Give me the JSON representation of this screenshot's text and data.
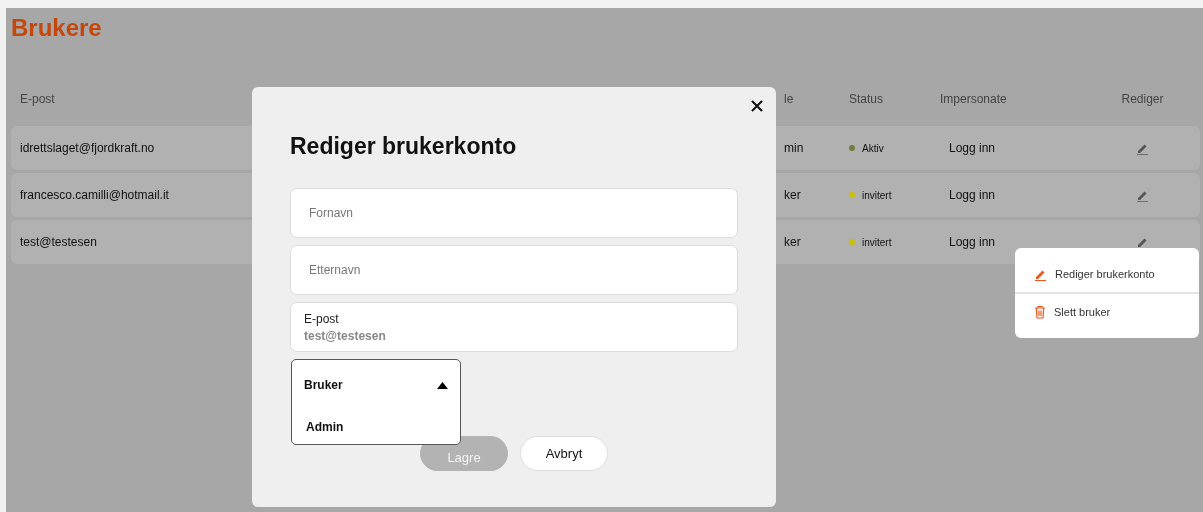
{
  "page_title": "Brukere",
  "table": {
    "columns": [
      "E-post",
      "le",
      "Status",
      "Impersonate",
      "Rediger"
    ],
    "rows": [
      {
        "email": "idrettslaget@fjordkraft.no",
        "column_2": "min",
        "status": "Aktiv",
        "color": "#6e7d3c",
        "impersonate": "Logg inn"
      },
      {
        "email": "francesco.camilli@hotmail.it",
        "column_2": "ker",
        "status": "invitert",
        "color": "#c9c200",
        "impersonate": "Logg inn"
      },
      {
        "email": "test@testesen",
        "column_2": "ker",
        "status": "invitert",
        "color": "#c9c200",
        "impersonate": "Logg inn"
      }
    ]
  },
  "modal": {
    "title": "Rediger brukerkonto",
    "fields": [
      {
        "placeholder": "Fornavn"
      },
      {
        "placeholder": "Etternavn"
      },
      {
        "label": "E-post",
        "value": "test@testesen"
      }
    ],
    "role_select": {
      "value": "Bruker",
      "expanded": true,
      "options": [
        "Admin"
      ]
    },
    "buttons": [
      {
        "label": "Lagre",
        "disabled": true
      },
      {
        "label": "Avbryt",
        "disabled": false
      }
    ]
  },
  "context_menu": [
    {
      "kind": "edit",
      "label": "Rediger brukerkonto"
    },
    {
      "kind": "delete",
      "label": "Slett bruker"
    }
  ]
}
